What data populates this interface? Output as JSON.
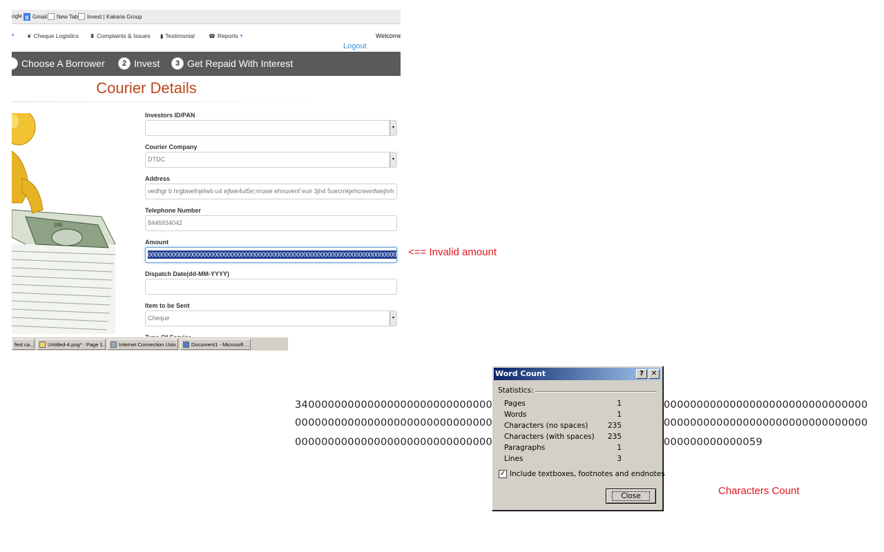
{
  "browser": {
    "bookmarks": [
      {
        "label": "ogle",
        "icon": "page-icon"
      },
      {
        "label": "Gmail",
        "icon": "google-icon"
      },
      {
        "label": "New Tab",
        "icon": "page-icon"
      },
      {
        "label": "Invest | Kakaria Group",
        "icon": "page-icon"
      }
    ]
  },
  "site_nav": {
    "items": [
      {
        "label": "Cheque Logistics",
        "icon": "leaf-icon"
      },
      {
        "label": "Complaints & Issues",
        "icon": "tower-icon"
      },
      {
        "label": "Testimonial",
        "icon": "book-icon"
      },
      {
        "label": "Reports",
        "icon": "phone-icon"
      }
    ],
    "welcome": "Welcome",
    "logout": "Logout"
  },
  "steps": [
    {
      "num": "",
      "label": "Choose A Borrower"
    },
    {
      "num": "2",
      "label": "Invest"
    },
    {
      "num": "3",
      "label": "Get Repaid With Interest"
    }
  ],
  "form": {
    "title": "Courier Details",
    "investors_id": {
      "label": "Investors ID/PAN",
      "value": ""
    },
    "courier_company": {
      "label": "Courier Company",
      "value": "DTDC"
    },
    "address": {
      "label": "Address",
      "value": "vedhgr b hrgbwefnjelwb u4 ejfwe4ut5e;nruwe  ehnuvenf`euir 3jh4 5uecmkjehcrewnfwejhrh"
    },
    "telephone": {
      "label": "Telephone Number",
      "value": "8446934042"
    },
    "amount": {
      "label": "Amount",
      "value": "00000000000000000000000000000000000000000000000000000000000000000000000000000000"
    },
    "dispatch_date": {
      "label": "Dispatch Date(dd-MM-YYYY)",
      "value": ""
    },
    "item_to_send": {
      "label": "Item to be Sent",
      "value": "Cheque"
    },
    "type_of_service": {
      "label": "Type Of Service"
    }
  },
  "taskbar": {
    "items": [
      "fest ca...",
      "Untitled-4.png* : Page 1...",
      "Internet Connection Usin...",
      "Document1 - Microsoft ..."
    ]
  },
  "annotations": {
    "invalid_amount": "<== Invalid amount",
    "characters_count": "Characters Count"
  },
  "digits": {
    "line1_left": "3400000000000000000000000000000",
    "line1_right": "0000000000000000000000000000000",
    "line2_left": "0000000000000000000000000000000",
    "line2_right": "0000000000000000000000000000000",
    "line3_left": "0000000000000000000000000000000",
    "line3_right": "000000000000059"
  },
  "word_count": {
    "title": "Word Count",
    "help_button": "?",
    "close_x": "✕",
    "statistics_label": "Statistics:",
    "rows": [
      {
        "label": "Pages",
        "value": "1"
      },
      {
        "label": "Words",
        "value": "1"
      },
      {
        "label": "Characters (no spaces)",
        "value": "235"
      },
      {
        "label": "Characters (with spaces)",
        "value": "235"
      },
      {
        "label": "Paragraphs",
        "value": "1"
      },
      {
        "label": "Lines",
        "value": "3"
      }
    ],
    "include_label": "Include textboxes, footnotes and endnotes",
    "include_checked": "✓",
    "close_button": "Close"
  },
  "colors": {
    "accent_orange": "#c0451a",
    "annotation_red": "#e0141a",
    "step_bar": "#5a5a5a",
    "dialog_title": "#0a246a"
  }
}
